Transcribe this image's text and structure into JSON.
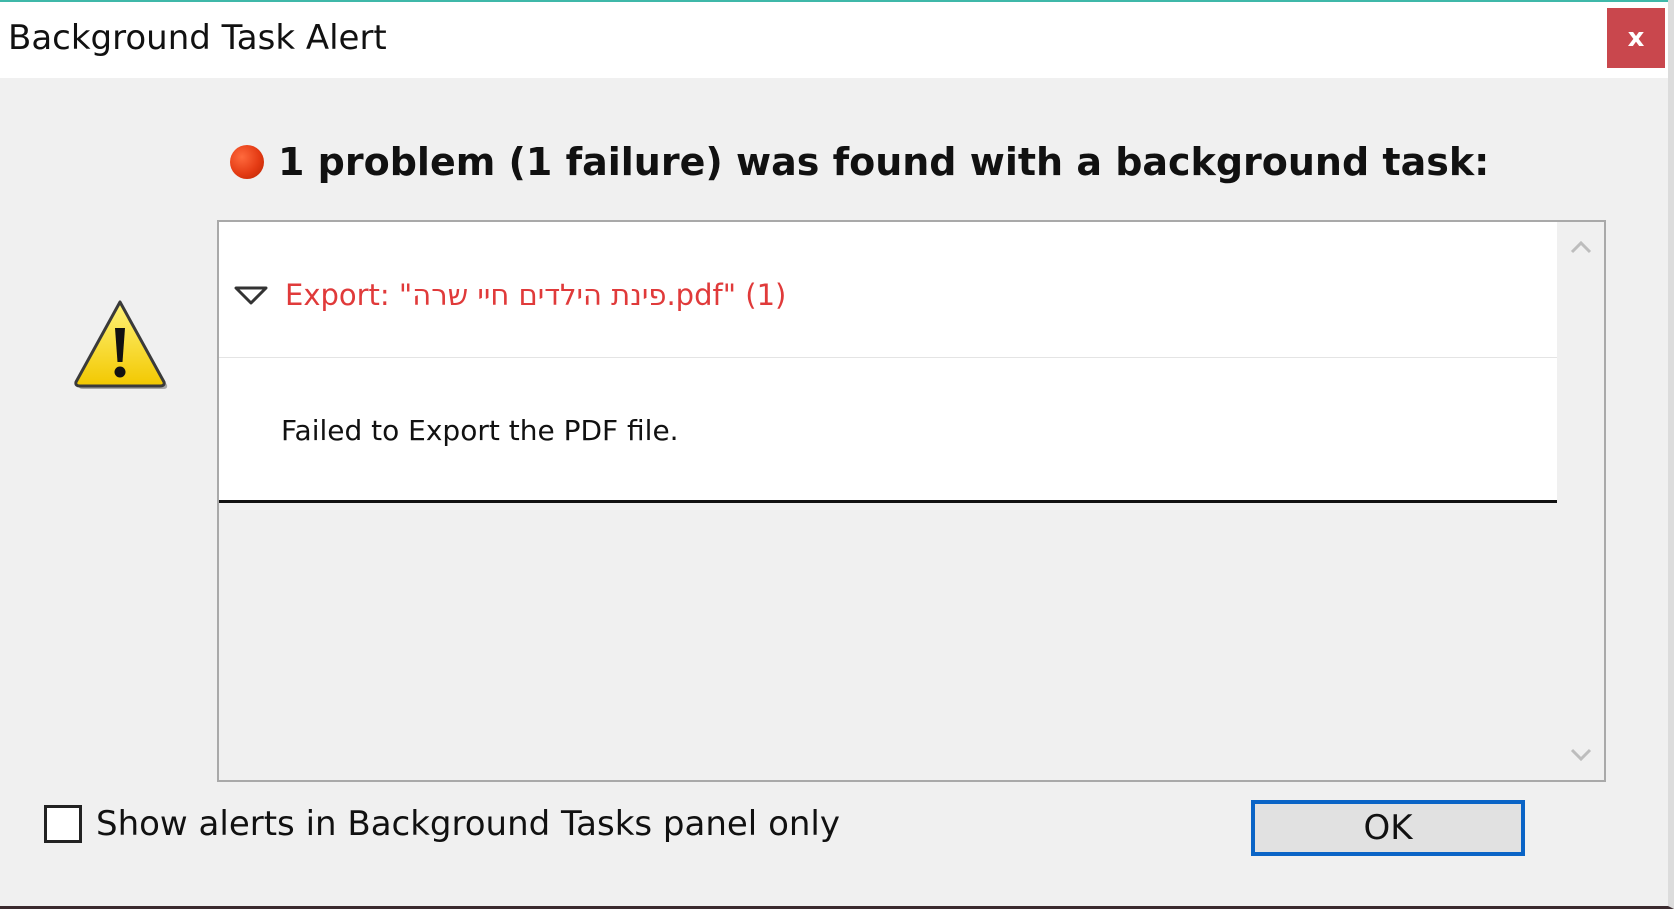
{
  "window": {
    "title": "Background Task Alert",
    "close_label": "x"
  },
  "alert": {
    "headline": "1 problem (1 failure) was found with a background task:",
    "status": "failure",
    "icon": "warning-triangle-icon"
  },
  "tasks": [
    {
      "title": "Export: \"פינת הילדים חיי שרה.pdf\" (1)",
      "detail": "Failed to Export the PDF file.",
      "expanded": true
    }
  ],
  "footer": {
    "checkbox_label": "Show alerts in Background Tasks panel only",
    "checkbox_checked": false,
    "ok_label": "OK"
  },
  "colors": {
    "close_button": "#c9474d",
    "error_text": "#e03a3a",
    "status_dot": "#e43b14",
    "default_button_border": "#0a64c6",
    "dialog_background": "#f0f0f0"
  }
}
